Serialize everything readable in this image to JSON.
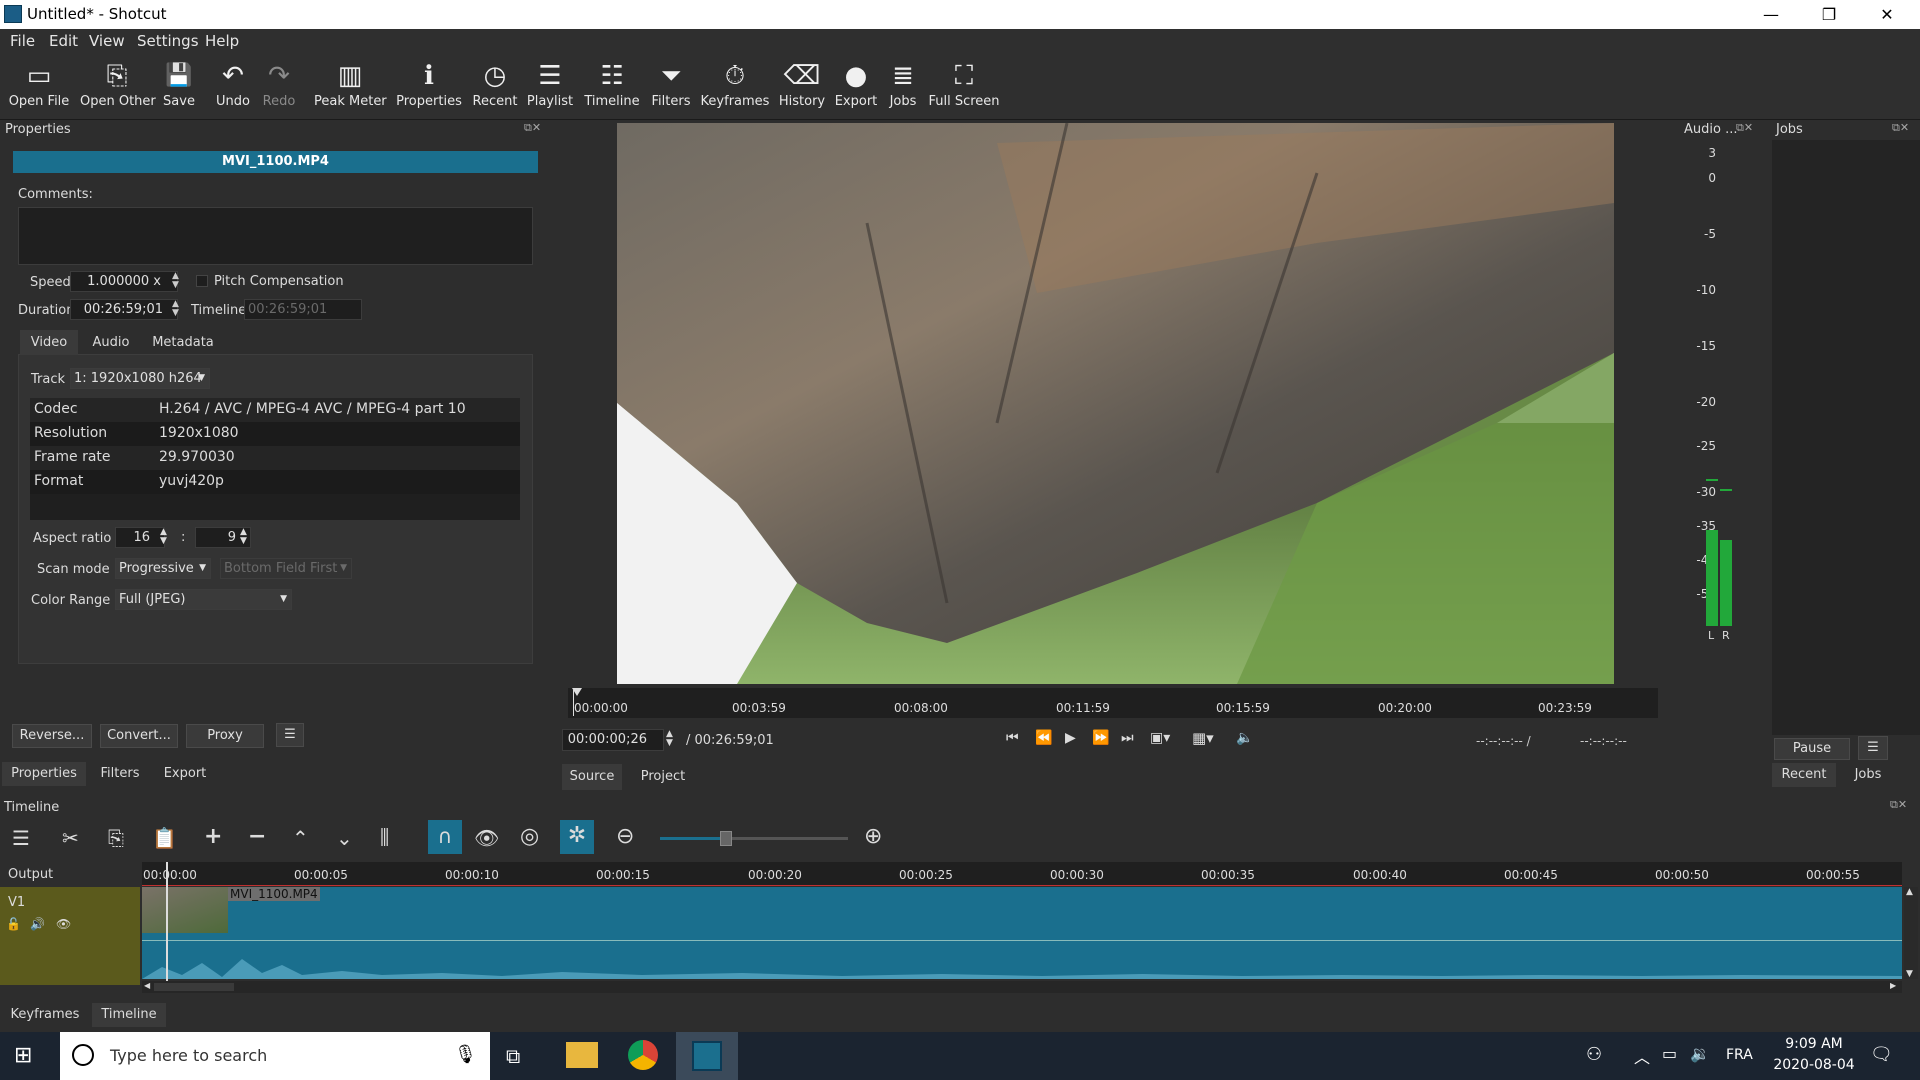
{
  "window": {
    "title": "Untitled* - Shotcut",
    "minimize": "—",
    "maximize": "❐",
    "close": "✕"
  },
  "menu": [
    "File",
    "Edit",
    "View",
    "Settings",
    "Help"
  ],
  "toolbar": [
    {
      "label": "Open File",
      "icon": "▭"
    },
    {
      "label": "Open Other",
      "icon": "⎘"
    },
    {
      "label": "Save",
      "icon": "💾"
    },
    {
      "label": "Undo",
      "icon": "↶"
    },
    {
      "label": "Redo",
      "icon": "↷"
    },
    {
      "label": "Peak Meter",
      "icon": "▥"
    },
    {
      "label": "Properties",
      "icon": "ℹ"
    },
    {
      "label": "Recent",
      "icon": "◷"
    },
    {
      "label": "Playlist",
      "icon": "☰"
    },
    {
      "label": "Timeline",
      "icon": "☷"
    },
    {
      "label": "Filters",
      "icon": "⏷"
    },
    {
      "label": "Keyframes",
      "icon": "⏱"
    },
    {
      "label": "History",
      "icon": "⌫"
    },
    {
      "label": "Export",
      "icon": "●"
    },
    {
      "label": "Jobs",
      "icon": "≣"
    },
    {
      "label": "Full Screen",
      "icon": "⛶"
    }
  ],
  "properties": {
    "panel_title": "Properties",
    "clip_name": "MVI_1100.MP4",
    "comments_label": "Comments:",
    "speed_label": "Speed",
    "speed_value": "1.000000 x",
    "pitch_label": "Pitch Compensation",
    "duration_label": "Duration",
    "duration_value": "00:26:59;01",
    "timeline_label": "Timeline",
    "timeline_value": "00:26:59;01",
    "tabs": [
      "Video",
      "Audio",
      "Metadata"
    ],
    "track_label": "Track",
    "track_value": "1: 1920x1080 h264",
    "info": [
      {
        "key": "Codec",
        "value": "H.264 / AVC / MPEG-4 AVC / MPEG-4 part 10"
      },
      {
        "key": "Resolution",
        "value": "1920x1080"
      },
      {
        "key": "Frame rate",
        "value": "29.970030"
      },
      {
        "key": "Format",
        "value": "yuvj420p"
      }
    ],
    "aspect_label": "Aspect ratio",
    "aspect_w": "16",
    "aspect_sep": ":",
    "aspect_h": "9",
    "scan_label": "Scan mode",
    "scan_value": "Progressive",
    "field_order": "Bottom Field First",
    "color_label": "Color Range",
    "color_value": "Full (JPEG)",
    "buttons": [
      "Reverse...",
      "Convert...",
      "Proxy"
    ],
    "bottom_tabs": [
      "Properties",
      "Filters",
      "Export"
    ]
  },
  "player": {
    "ruler": [
      "00:00:00",
      "00:03:59",
      "00:08:00",
      "00:11:59",
      "00:15:59",
      "00:20:00",
      "00:23:59"
    ],
    "current_time": "00:00:00;26",
    "total_time": "/ 00:26:59;01",
    "in_point": "--:--:--:-- /",
    "out_point": "--:--:--:--",
    "tabs": [
      "Source",
      "Project"
    ]
  },
  "audio": {
    "title": "Audio ...",
    "scale": [
      "3",
      "0",
      "-5",
      "-10",
      "-15",
      "-20",
      "-25",
      "-30",
      "-35",
      "-40",
      "-50"
    ],
    "left": "L",
    "right": "R",
    "level_left": 0.2,
    "level_right": 0.18
  },
  "jobs": {
    "title": "Jobs",
    "pause": "Pause",
    "tabs": [
      "Recent",
      "Jobs"
    ]
  },
  "timeline": {
    "title": "Timeline",
    "output_label": "Output",
    "track_name": "V1",
    "clip_name": "MVI_1100.MP4",
    "ruler": [
      "00:00:00",
      "00:00:05",
      "00:00:10",
      "00:00:15",
      "00:00:20",
      "00:00:25",
      "00:00:30",
      "00:00:35",
      "00:00:40",
      "00:00:45",
      "00:00:50",
      "00:00:55"
    ],
    "bottom_tabs": [
      "Keyframes",
      "Timeline"
    ],
    "zoom": 0.35
  },
  "taskbar": {
    "search_placeholder": "Type here to search",
    "lang": "FRA",
    "time": "9:09 AM",
    "date": "2020-08-04"
  },
  "colors": {
    "accent": "#1a6f8e",
    "track_bg": "#1a6f8e",
    "track_header": "#5b5a1c",
    "meter": "#22a83a"
  }
}
